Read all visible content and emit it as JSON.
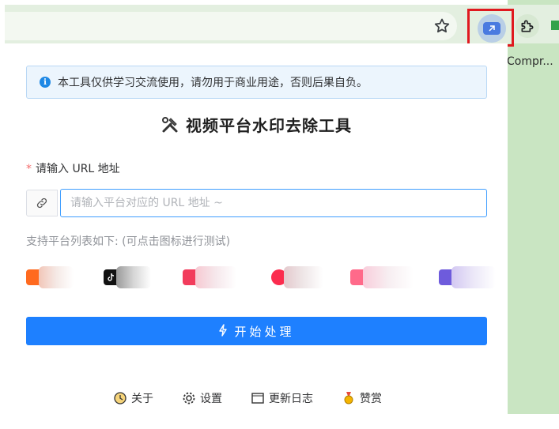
{
  "browser": {
    "partial_tab_text": "Compr...",
    "colors": {
      "toolbar": "#e3efe0",
      "side": "#c9e5c2",
      "highlight_box": "#e0191f"
    }
  },
  "notice": {
    "text": "本工具仅供学习交流使用，请勿用于商业用途，否则后果自负。",
    "icon": "info-icon"
  },
  "title": "视频平台水印去除工具",
  "form": {
    "label": "请输入 URL 地址",
    "required_mark": "*",
    "placeholder": "请输入平台对应的 URL 地址 ~"
  },
  "supported_text": "支持平台列表如下: (可点击图标进行测试)",
  "platforms": [
    {
      "logo_color": "#ff6a1f",
      "icon": "platform-logo"
    },
    {
      "logo_color": "#111111",
      "icon": "tiktok-icon"
    },
    {
      "logo_color": "#f23c5c",
      "icon": "platform-logo"
    },
    {
      "logo_color": "#fb2c4e",
      "icon": "platform-logo"
    },
    {
      "logo_color": "#ff6a8a",
      "icon": "platform-logo"
    },
    {
      "logo_color": "#6e5bdc",
      "icon": "platform-logo"
    }
  ],
  "primary_button": {
    "label": "开始处理",
    "icon": "lightning-icon",
    "color": "#1e80ff"
  },
  "footer": [
    {
      "label": "关于",
      "icon": "clock-icon"
    },
    {
      "label": "设置",
      "icon": "gear-icon"
    },
    {
      "label": "更新日志",
      "icon": "book-icon"
    },
    {
      "label": "赞赏",
      "icon": "medal-icon"
    }
  ]
}
